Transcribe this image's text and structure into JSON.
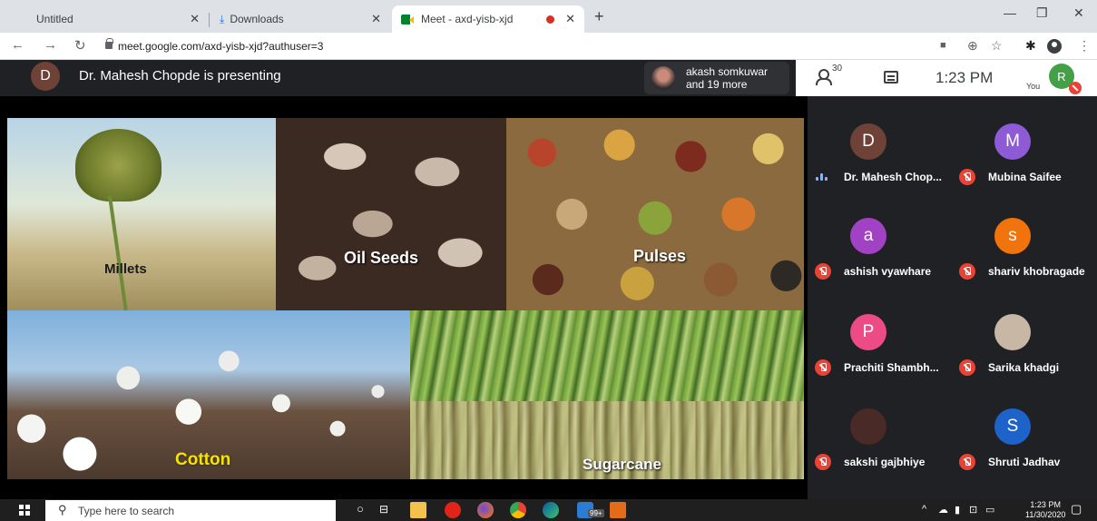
{
  "browser": {
    "tabs": [
      {
        "title": "Untitled",
        "active": false
      },
      {
        "title": "Downloads",
        "active": false
      },
      {
        "title": "Meet - axd-yisb-xjd",
        "active": true
      }
    ],
    "url": "meet.google.com/axd-yisb-xjd?authuser=3"
  },
  "meet": {
    "presenter_initial": "D",
    "presenting_text": "Dr. Mahesh Chopde is presenting",
    "others_line1": "akash somkuwar",
    "others_line2": "and 19 more",
    "people_count": "30",
    "time": "1:23 PM",
    "you_label": "You",
    "you_initial": "R"
  },
  "slide": {
    "labels": {
      "millets": "Millets",
      "oilseeds": "Oil Seeds",
      "pulses": "Pulses",
      "cotton": "Cotton",
      "sugarcane": "Sugarcane"
    }
  },
  "participants": [
    {
      "initial": "D",
      "name": "Dr. Mahesh Chop...",
      "color": "#6e4236",
      "status": "speaking"
    },
    {
      "initial": "M",
      "name": "Mubina Saifee",
      "color": "#8e5bd6",
      "status": "muted"
    },
    {
      "initial": "a",
      "name": "ashish vyawhare",
      "color": "#a142c4",
      "status": "muted"
    },
    {
      "initial": "s",
      "name": "shariv khobragade",
      "color": "#f0730b",
      "status": "muted"
    },
    {
      "initial": "P",
      "name": "Prachiti Shambh...",
      "color": "#ec4b86",
      "status": "muted"
    },
    {
      "initial": "",
      "name": "Sarika khadgi",
      "color": "#c9b7a6",
      "status": "muted"
    },
    {
      "initial": "",
      "name": "sakshi gajbhiye",
      "color": "#4a2a26",
      "status": "muted"
    },
    {
      "initial": "S",
      "name": "Shruti Jadhav",
      "color": "#1e63c9",
      "status": "muted"
    }
  ],
  "taskbar": {
    "search_placeholder": "Type here to search",
    "clock_time": "1:23 PM",
    "clock_date": "11/30/2020",
    "badge": "99+"
  }
}
